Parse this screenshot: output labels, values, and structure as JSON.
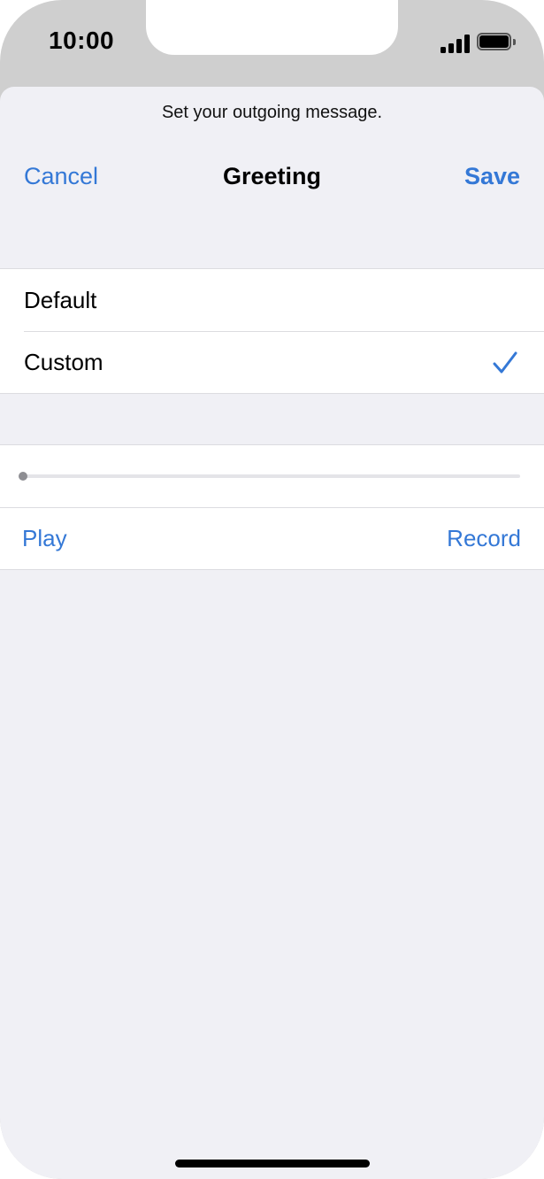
{
  "status_bar": {
    "time": "10:00",
    "signal_icon": "cellular-signal-icon",
    "battery_icon": "battery-icon"
  },
  "sheet": {
    "prompt": "Set your outgoing message.",
    "nav": {
      "cancel": "Cancel",
      "title": "Greeting",
      "save": "Save"
    },
    "options": [
      {
        "label": "Default",
        "selected": false
      },
      {
        "label": "Custom",
        "selected": true
      }
    ],
    "playback": {
      "progress": 0,
      "play": "Play",
      "record": "Record"
    }
  },
  "colors": {
    "accent": "#3478d6",
    "background": "#f0f0f5",
    "separator": "#dcdce0"
  }
}
